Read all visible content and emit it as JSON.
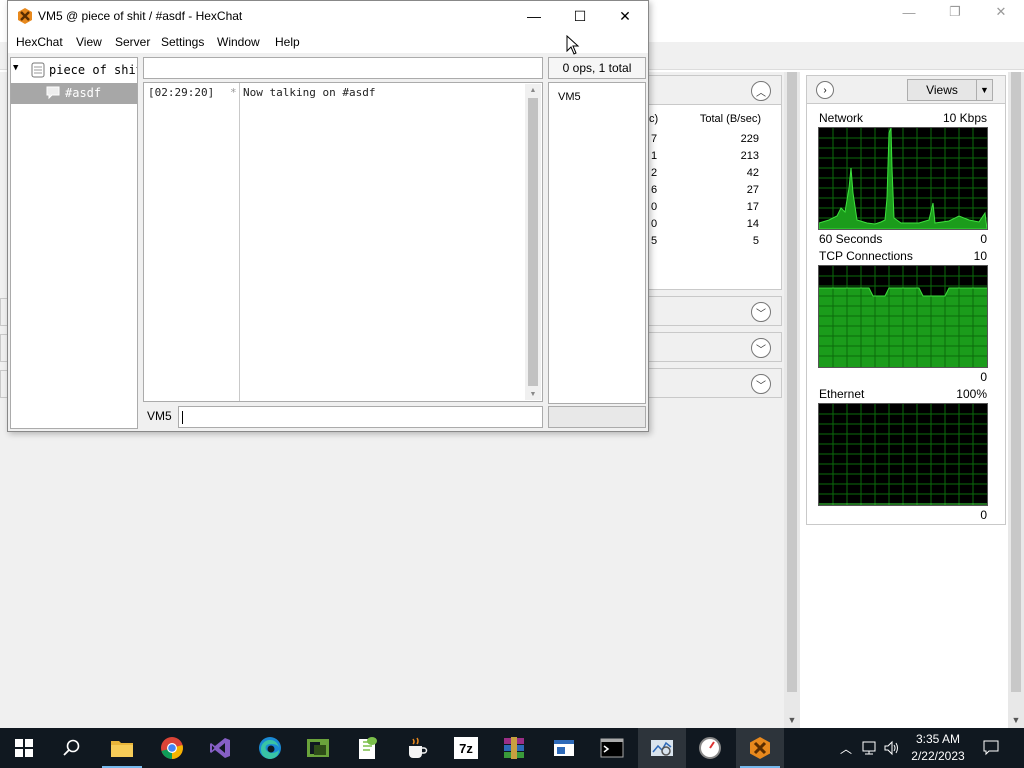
{
  "resmon": {
    "net_columns": {
      "col1": "c)",
      "col2": "Total (B/sec)"
    },
    "net_rows": [
      {
        "c1": "7",
        "total": "229"
      },
      {
        "c1": "1",
        "total": "213"
      },
      {
        "c1": "2",
        "total": "42"
      },
      {
        "c1": "6",
        "total": "27"
      },
      {
        "c1": "0",
        "total": "17"
      },
      {
        "c1": "0",
        "total": "14"
      },
      {
        "c1": "5",
        "total": "5"
      }
    ],
    "views_label": "Views",
    "graphs": {
      "network": {
        "title": "Network",
        "max": "10 Kbps",
        "time": "60 Seconds",
        "min": "0"
      },
      "tcp": {
        "title": "TCP Connections",
        "max": "10",
        "min": "0"
      },
      "ethernet": {
        "title": "Ethernet",
        "max": "100%",
        "min": "0"
      }
    }
  },
  "hexchat": {
    "title": "VM5 @ piece of shit / #asdf - HexChat",
    "menu": [
      "HexChat",
      "View",
      "Server",
      "Settings",
      "Window",
      "Help"
    ],
    "server_node": "piece of shit",
    "channel_node": "#asdf",
    "ops_status": "0 ops, 1 total",
    "messages": [
      {
        "time": "[02:29:20]",
        "prefix": "*",
        "text": "Now talking on #asdf"
      }
    ],
    "users": [
      "VM5"
    ],
    "nick": "VM5",
    "input_value": ""
  },
  "taskbar": {
    "time": "3:35 AM",
    "date": "2/22/2023",
    "apps": [
      "start",
      "search",
      "file-explorer",
      "chrome",
      "visual-studio",
      "edge",
      "gpu-app",
      "notepad-plus",
      "java",
      "7zip",
      "winrar",
      "app-window",
      "command-prompt",
      "resource-monitor",
      "system-clock",
      "hexchat"
    ]
  }
}
